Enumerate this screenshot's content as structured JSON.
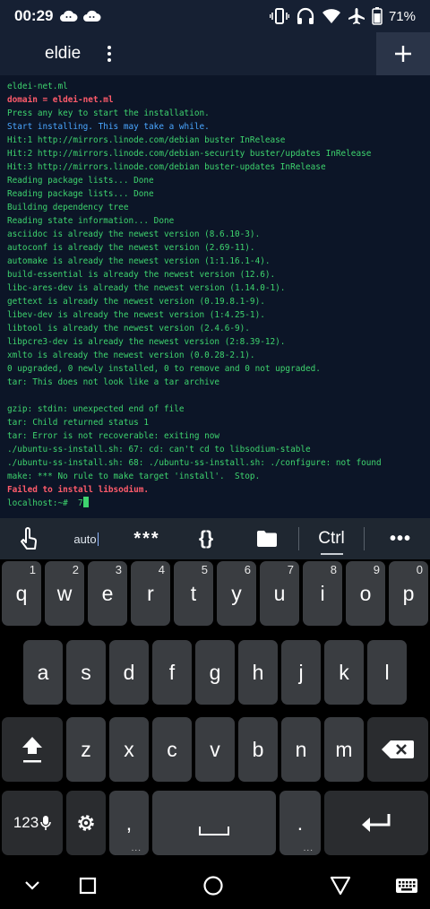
{
  "status_bar": {
    "time": "00:29",
    "notification_icons": [
      "cloud-smile-icon",
      "cloud-smile-icon"
    ],
    "system_icons": [
      "vibrate-icon",
      "headphones-icon",
      "wifi-icon",
      "airplane-icon",
      "battery-icon"
    ],
    "battery": "71%"
  },
  "app_bar": {
    "session_title": "eldie",
    "menu_icon": "more-vert-icon",
    "add_icon": "plus-icon"
  },
  "terminal": {
    "lines": [
      {
        "text": "eldei-net.ml",
        "color": "green",
        "bold": false
      },
      {
        "text": "domain = eldei-net.ml",
        "color": "red",
        "bold": true
      },
      {
        "text": "Press any key to start the installation.",
        "color": "green",
        "bold": false
      },
      {
        "text": "Start installing. This may take a while.",
        "color": "blue",
        "bold": false
      },
      {
        "text": "Hit:1 http://mirrors.linode.com/debian buster InRelease",
        "color": "green",
        "bold": false
      },
      {
        "text": "Hit:2 http://mirrors.linode.com/debian-security buster/updates InRelease",
        "color": "green",
        "bold": false
      },
      {
        "text": "Hit:3 http://mirrors.linode.com/debian buster-updates InRelease",
        "color": "green",
        "bold": false
      },
      {
        "text": "Reading package lists... Done",
        "color": "green",
        "bold": false
      },
      {
        "text": "Reading package lists... Done",
        "color": "green",
        "bold": false
      },
      {
        "text": "Building dependency tree",
        "color": "green",
        "bold": false
      },
      {
        "text": "Reading state information... Done",
        "color": "green",
        "bold": false
      },
      {
        "text": "asciidoc is already the newest version (8.6.10-3).",
        "color": "green",
        "bold": false
      },
      {
        "text": "autoconf is already the newest version (2.69-11).",
        "color": "green",
        "bold": false
      },
      {
        "text": "automake is already the newest version (1:1.16.1-4).",
        "color": "green",
        "bold": false
      },
      {
        "text": "build-essential is already the newest version (12.6).",
        "color": "green",
        "bold": false
      },
      {
        "text": "libc-ares-dev is already the newest version (1.14.0-1).",
        "color": "green",
        "bold": false
      },
      {
        "text": "gettext is already the newest version (0.19.8.1-9).",
        "color": "green",
        "bold": false
      },
      {
        "text": "libev-dev is already the newest version (1:4.25-1).",
        "color": "green",
        "bold": false
      },
      {
        "text": "libtool is already the newest version (2.4.6-9).",
        "color": "green",
        "bold": false
      },
      {
        "text": "libpcre3-dev is already the newest version (2:8.39-12).",
        "color": "green",
        "bold": false
      },
      {
        "text": "xmlto is already the newest version (0.0.28-2.1).",
        "color": "green",
        "bold": false
      },
      {
        "text": "0 upgraded, 0 newly installed, 0 to remove and 0 not upgraded.",
        "color": "green",
        "bold": false
      },
      {
        "text": "tar: This does not look like a tar archive",
        "color": "green",
        "bold": false
      },
      {
        "text": "",
        "color": "green",
        "bold": false
      },
      {
        "text": "gzip: stdin: unexpected end of file",
        "color": "green",
        "bold": false
      },
      {
        "text": "tar: Child returned status 1",
        "color": "green",
        "bold": false
      },
      {
        "text": "tar: Error is not recoverable: exiting now",
        "color": "green",
        "bold": false
      },
      {
        "text": "./ubuntu-ss-install.sh: 67: cd: can't cd to libsodium-stable",
        "color": "green",
        "bold": false
      },
      {
        "text": "./ubuntu-ss-install.sh: 68: ./ubuntu-ss-install.sh: ./configure: not found",
        "color": "green",
        "bold": false
      },
      {
        "text": "make: *** No rule to make target 'install'.  Stop.",
        "color": "green",
        "bold": false
      },
      {
        "text": "Failed to install libsodium.",
        "color": "red",
        "bold": true
      },
      {
        "text": "localhost:~#  7",
        "color": "green",
        "bold": false
      }
    ]
  },
  "extra_keys": {
    "touch_icon": "touch-hand-icon",
    "auto_label": "auto",
    "stars_label": "***",
    "braces_label": "{}",
    "folder_icon": "folder-icon",
    "ctrl_label": "Ctrl",
    "more_label": "•••"
  },
  "keyboard": {
    "row1": [
      {
        "key": "q",
        "hint": "1"
      },
      {
        "key": "w",
        "hint": "2"
      },
      {
        "key": "e",
        "hint": "3"
      },
      {
        "key": "r",
        "hint": "4"
      },
      {
        "key": "t",
        "hint": "5"
      },
      {
        "key": "y",
        "hint": "6"
      },
      {
        "key": "u",
        "hint": "7"
      },
      {
        "key": "i",
        "hint": "8"
      },
      {
        "key": "o",
        "hint": "9"
      },
      {
        "key": "p",
        "hint": "0"
      }
    ],
    "row2": [
      "a",
      "s",
      "d",
      "f",
      "g",
      "h",
      "j",
      "k",
      "l"
    ],
    "row3": [
      "z",
      "x",
      "c",
      "v",
      "b",
      "n",
      "m"
    ],
    "symbols_label": "123",
    "comma": ",",
    "period": ".",
    "longpress_dots": "..."
  },
  "nav_bar": {
    "icons": [
      "chevron-down-icon",
      "recents-square-icon",
      "home-circle-icon",
      "back-triangle-icon",
      "keyboard-icon"
    ]
  }
}
